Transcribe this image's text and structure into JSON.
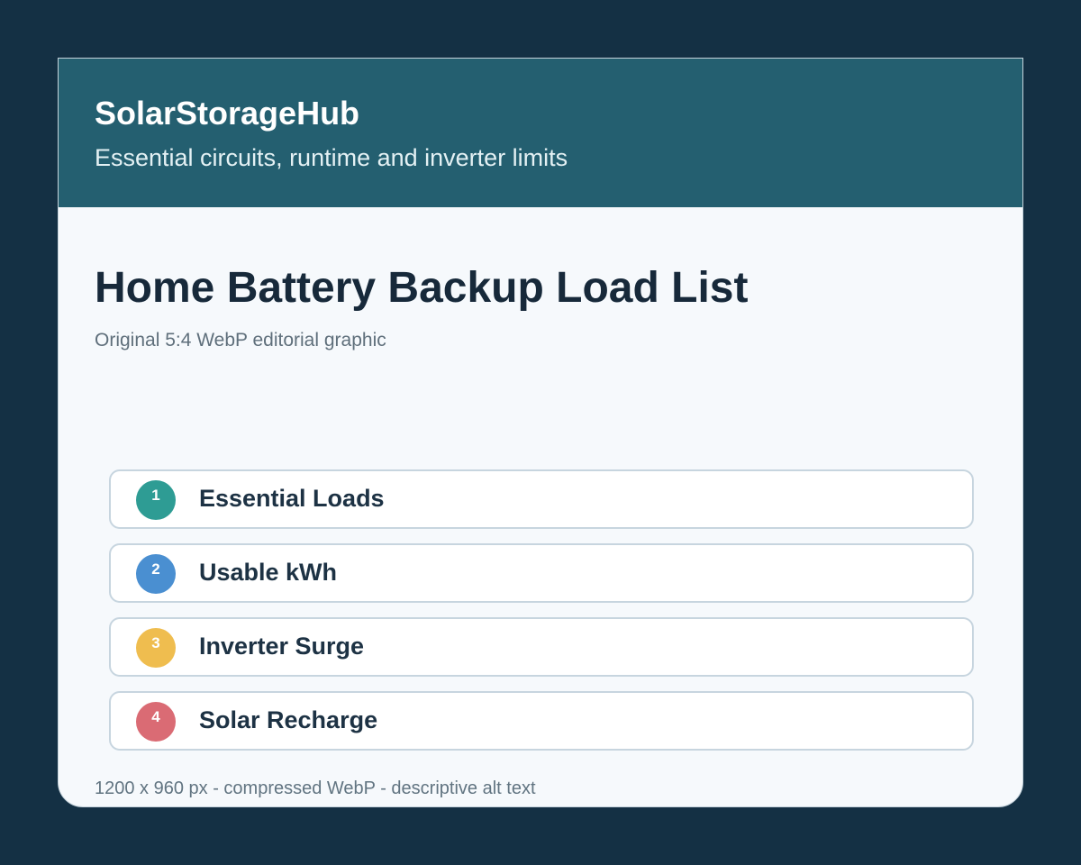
{
  "header": {
    "brand": "SolarStorageHub",
    "tagline": "Essential circuits, runtime and inverter limits"
  },
  "main": {
    "title": "Home Battery Backup Load List",
    "subtitle": "Original 5:4 WebP editorial graphic"
  },
  "items": [
    {
      "number": "1",
      "label": "Essential Loads",
      "color": "#2e9c94"
    },
    {
      "number": "2",
      "label": "Usable kWh",
      "color": "#4a8fd1"
    },
    {
      "number": "3",
      "label": "Inverter Surge",
      "color": "#efbd4f"
    },
    {
      "number": "4",
      "label": "Solar Recharge",
      "color": "#da6b74"
    }
  ],
  "footer": {
    "text": "1200 x 960 px - compressed WebP - descriptive alt text"
  }
}
